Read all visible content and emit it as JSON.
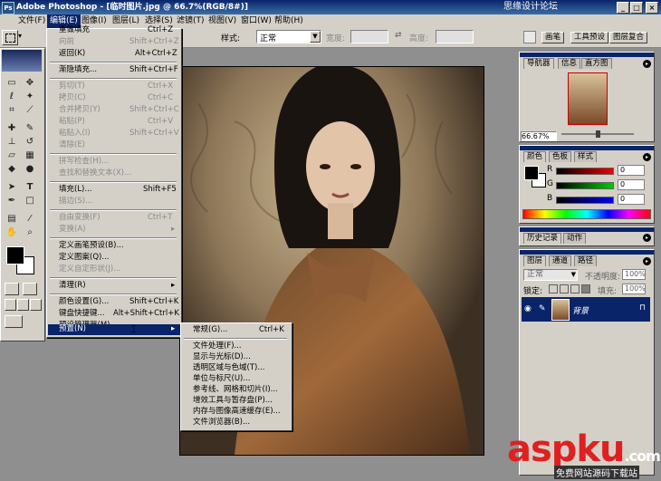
{
  "titlebar": {
    "app_title": "Adobe Photoshop - [临时图片.jpg @ 66.7%(RGB/8#)]",
    "watermark": "思缘设计论坛",
    "min": "_",
    "max": "□",
    "close": "×"
  },
  "menubar": {
    "items": [
      "文件(F)",
      "编辑(E)",
      "图像(I)",
      "图层(L)",
      "选择(S)",
      "滤镜(T)",
      "视图(V)",
      "窗口(W)",
      "帮助(H)"
    ]
  },
  "options_bar": {
    "style_label": "样式:",
    "style_value": "正常",
    "width_label": "宽度:",
    "height_label": "高度:",
    "swap": "⇄",
    "tabs": [
      "画笔",
      "工具预设",
      "图层复合"
    ]
  },
  "edit_menu": {
    "items": [
      {
        "label": "重做填充",
        "shortcut": "Ctrl+Z",
        "disabled": false
      },
      {
        "label": "向前",
        "shortcut": "Shift+Ctrl+Z",
        "disabled": true
      },
      {
        "label": "返回(K)",
        "shortcut": "Alt+Ctrl+Z",
        "disabled": false
      },
      {
        "label": "渐隐填充...",
        "shortcut": "Shift+Ctrl+F",
        "disabled": false
      },
      {
        "label": "剪切(T)",
        "shortcut": "Ctrl+X",
        "disabled": true
      },
      {
        "label": "拷贝(C)",
        "shortcut": "Ctrl+C",
        "disabled": true
      },
      {
        "label": "合并拷贝(Y)",
        "shortcut": "Shift+Ctrl+C",
        "disabled": true
      },
      {
        "label": "粘贴(P)",
        "shortcut": "Ctrl+V",
        "disabled": true
      },
      {
        "label": "粘贴入(I)",
        "shortcut": "Shift+Ctrl+V",
        "disabled": true
      },
      {
        "label": "清除(E)",
        "shortcut": "",
        "disabled": true
      },
      {
        "label": "拼写检查(H)...",
        "shortcut": "",
        "disabled": true
      },
      {
        "label": "查找和替换文本(X)...",
        "shortcut": "",
        "disabled": true
      },
      {
        "label": "填充(L)...",
        "shortcut": "Shift+F5",
        "disabled": false
      },
      {
        "label": "描边(S)...",
        "shortcut": "",
        "disabled": true
      },
      {
        "label": "自由变换(F)",
        "shortcut": "Ctrl+T",
        "disabled": true
      },
      {
        "label": "变换(A)",
        "shortcut": "",
        "disabled": true
      },
      {
        "label": "定义画笔预设(B)...",
        "shortcut": "",
        "disabled": false
      },
      {
        "label": "定义图案(Q)...",
        "shortcut": "",
        "disabled": false
      },
      {
        "label": "定义自定形状(J)...",
        "shortcut": "",
        "disabled": true
      },
      {
        "label": "清理(R)",
        "shortcut": "",
        "disabled": false
      },
      {
        "label": "颜色设置(G)...",
        "shortcut": "Shift+Ctrl+K",
        "disabled": false
      },
      {
        "label": "键盘快捷键...",
        "shortcut": "Alt+Shift+Ctrl+K",
        "disabled": false
      },
      {
        "label": "预设管理器(M)...",
        "shortcut": "",
        "disabled": false
      },
      {
        "label": "预置(N)",
        "shortcut": "",
        "disabled": false
      }
    ]
  },
  "prefs_submenu": {
    "items": [
      {
        "label": "常规(G)...",
        "shortcut": "Ctrl+K"
      },
      {
        "label": "文件处理(F)...",
        "shortcut": ""
      },
      {
        "label": "显示与光标(D)...",
        "shortcut": ""
      },
      {
        "label": "透明区域与色域(T)...",
        "shortcut": ""
      },
      {
        "label": "单位与标尺(U)...",
        "shortcut": ""
      },
      {
        "label": "参考线、网格和切片(I)...",
        "shortcut": ""
      },
      {
        "label": "增效工具与暂存盘(P)...",
        "shortcut": ""
      },
      {
        "label": "内存与图像高速缓存(E)...",
        "shortcut": ""
      },
      {
        "label": "文件浏览器(B)...",
        "shortcut": ""
      }
    ]
  },
  "navigator": {
    "tabs": [
      "导航器",
      "信息",
      "直方图"
    ],
    "zoom": "66.67%"
  },
  "color_panel": {
    "tabs": [
      "颜色",
      "色板",
      "样式"
    ],
    "channels": [
      {
        "name": "R",
        "value": "0",
        "color": "#cc0000"
      },
      {
        "name": "G",
        "value": "0",
        "color": "#00aa00"
      },
      {
        "name": "B",
        "value": "0",
        "color": "#0000cc"
      }
    ]
  },
  "history_panel": {
    "tabs": [
      "历史记录",
      "动作"
    ]
  },
  "layers_panel": {
    "tabs": [
      "图层",
      "通道",
      "路径"
    ],
    "blend_mode": "正常",
    "opacity_label": "不透明度:",
    "opacity_value": "100%",
    "lock_label": "锁定:",
    "fill_label": "填充:",
    "fill_value": "100%",
    "layer_name": "背景"
  },
  "watermark_bottom": {
    "brand": "aspku",
    "tld": ".com",
    "subtitle": "免费网站源码下载站"
  }
}
